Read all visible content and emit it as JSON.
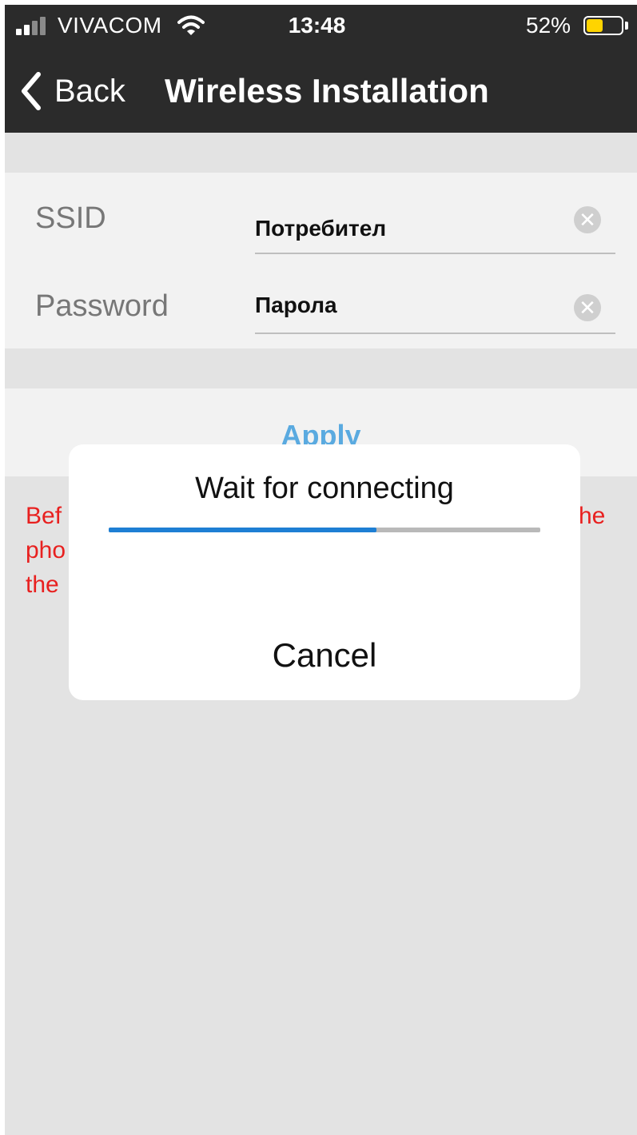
{
  "status_bar": {
    "carrier": "VIVACOM",
    "time": "13:48",
    "battery_percent": "52%",
    "battery_level": 0.52,
    "signal_bars_active": 2,
    "signal_bars_total": 4
  },
  "nav": {
    "back_label": "Back",
    "title": "Wireless Installation"
  },
  "form": {
    "ssid_label": "SSID",
    "ssid_value": "Потребител",
    "password_label": "Password",
    "password_value": "Парола",
    "apply_label": "Apply"
  },
  "note": {
    "visible_lines": [
      "Bef",
      "pho",
      "the"
    ],
    "visible_suffix": "he"
  },
  "dialog": {
    "title": "Wait for connecting",
    "progress": 0.62,
    "cancel_label": "Cancel"
  },
  "colors": {
    "nav_background": "#2b2b2b",
    "accent": "#5aaae0",
    "progress": "#1e7fd4",
    "note": "#e8201f",
    "battery": "#ffd400"
  }
}
